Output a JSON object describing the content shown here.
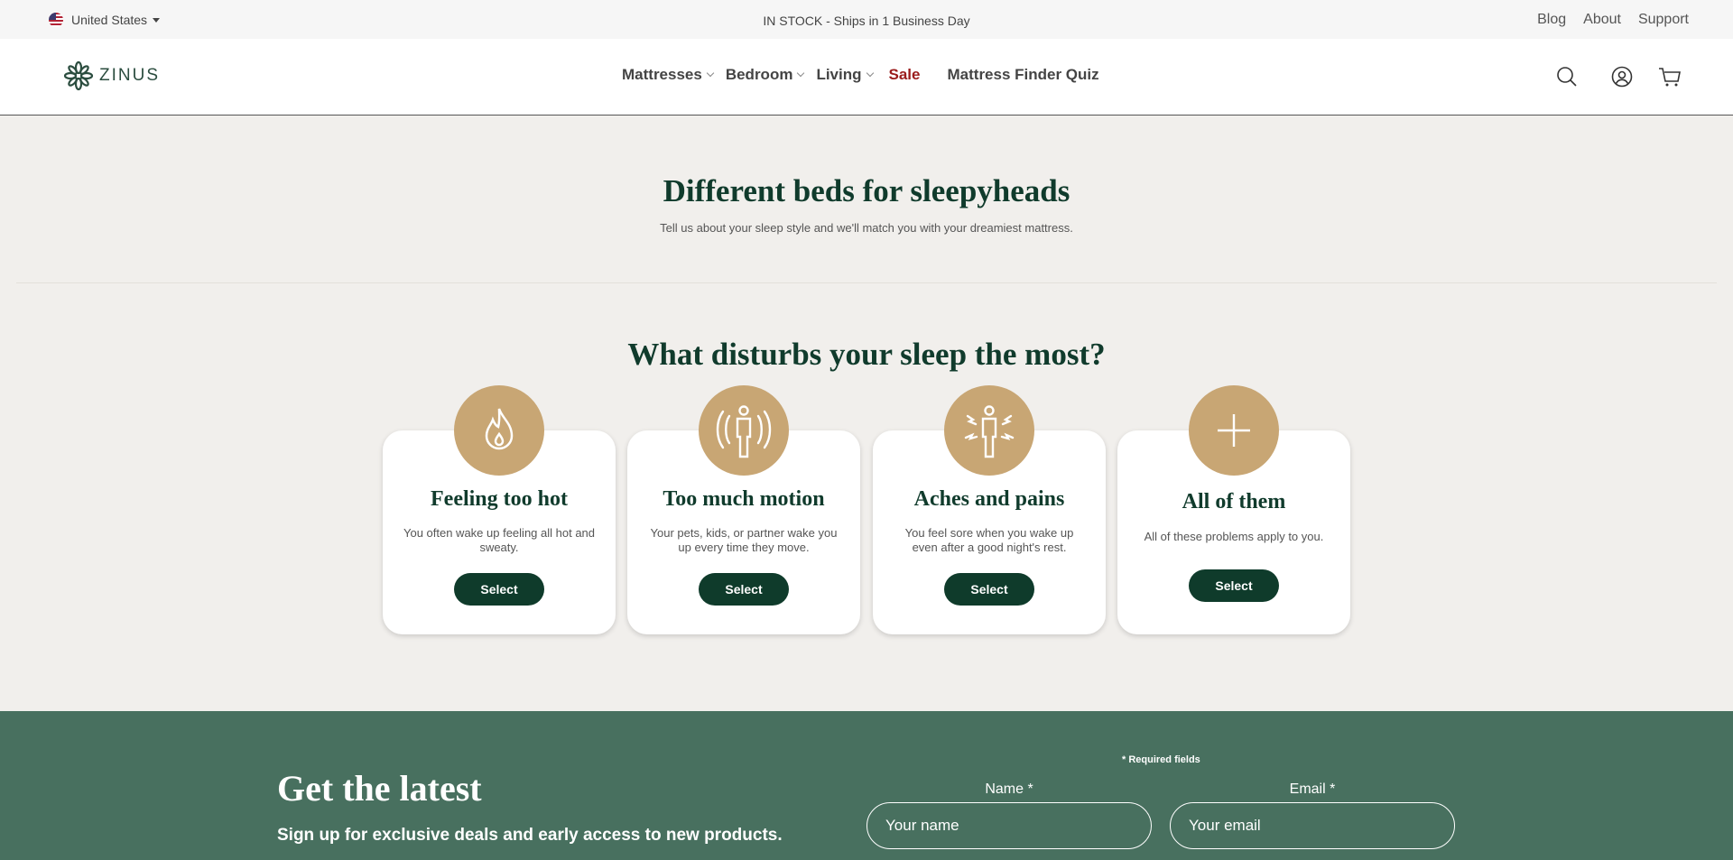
{
  "topbar": {
    "country": "United States",
    "stock_message": "IN STOCK - Ships in 1 Business Day",
    "links": [
      "Blog",
      "About",
      "Support"
    ]
  },
  "nav": {
    "logo_text": "ZINUS",
    "menu": {
      "mattresses": "Mattresses",
      "bedroom": "Bedroom",
      "living": "Living",
      "sale": "Sale",
      "quiz": "Mattress Finder Quiz"
    },
    "icons": [
      "search-icon",
      "account-icon",
      "cart-icon"
    ]
  },
  "hero": {
    "title": "Different beds for sleepyheads",
    "subtitle": "Tell us about your sleep style and we'll match you with your dreamiest mattress."
  },
  "question": {
    "title": "What disturbs your sleep the most?",
    "options": [
      {
        "title": "Feeling too hot",
        "text": "You often wake up feeling all hot and sweaty.",
        "button": "Select",
        "icon": "flame-icon"
      },
      {
        "title": "Too much motion",
        "text": "Your pets, kids, or partner wake you up every time they move.",
        "button": "Select",
        "icon": "motion-person-icon"
      },
      {
        "title": "Aches and pains",
        "text": "You feel sore when you wake up even after a good night's rest.",
        "button": "Select",
        "icon": "aches-person-icon"
      },
      {
        "title": "All of them",
        "text": "All of these problems apply to you.",
        "button": "Select",
        "icon": "plus-icon"
      }
    ]
  },
  "newsletter": {
    "title": "Get the latest",
    "subtitle": "Sign up for exclusive deals and early access to new products.",
    "required_note": "* Required fields",
    "name_label": "Name *",
    "name_placeholder": "Your name",
    "email_label": "Email *",
    "email_placeholder": "Your email"
  },
  "colors": {
    "brand_green": "#0f3b2b",
    "accent_tan": "#c8a674",
    "footer_green": "#48705f",
    "sale_red": "#9a1b1b",
    "page_bg": "#f1efec"
  }
}
